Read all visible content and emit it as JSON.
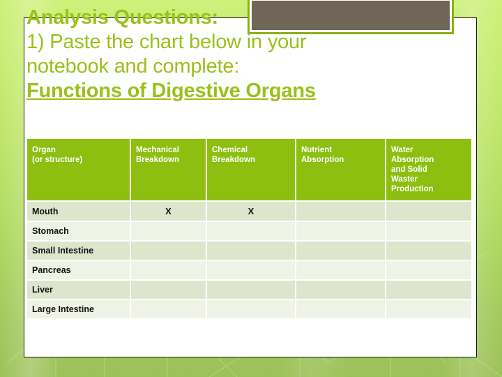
{
  "slide": {
    "heading_lines": [
      {
        "text": "Analysis Questions:",
        "bold": true,
        "underline": false
      },
      {
        "text": "1) Paste the chart below in your",
        "bold": false,
        "underline": false
      },
      {
        "text": "notebook and complete:",
        "bold": false,
        "underline": false
      },
      {
        "text": "Functions of Digestive Organs",
        "bold": true,
        "underline": true
      }
    ],
    "accent_color": "#9cbf1b",
    "header_fill": "#8cbf10",
    "picture_placeholder_color": "#6f6658"
  },
  "table": {
    "columns": [
      "Organ\n(or structure)",
      "Mechanical Breakdown",
      "Chemical Breakdown",
      "Nutrient Absorption",
      "Water Absorption and Solid Waster Production"
    ],
    "column_lines": [
      [
        "Organ",
        "(or structure)"
      ],
      [
        "Mechanical",
        "Breakdown"
      ],
      [
        "Chemical",
        "Breakdown"
      ],
      [
        "Nutrient",
        "Absorption"
      ],
      [
        "Water",
        "Absorption",
        "and Solid",
        "Waster",
        "Production"
      ]
    ],
    "rows": [
      {
        "organ": "Mouth",
        "mechanical": "X",
        "chemical": "X",
        "nutrient": "",
        "water": ""
      },
      {
        "organ": "Stomach",
        "mechanical": "",
        "chemical": "",
        "nutrient": "",
        "water": ""
      },
      {
        "organ": "Small Intestine",
        "mechanical": "",
        "chemical": "",
        "nutrient": "",
        "water": ""
      },
      {
        "organ": "Pancreas",
        "mechanical": "",
        "chemical": "",
        "nutrient": "",
        "water": ""
      },
      {
        "organ": "Liver",
        "mechanical": "",
        "chemical": "",
        "nutrient": "",
        "water": ""
      },
      {
        "organ": "Large Intestine",
        "mechanical": "",
        "chemical": "",
        "nutrient": "",
        "water": ""
      }
    ]
  }
}
